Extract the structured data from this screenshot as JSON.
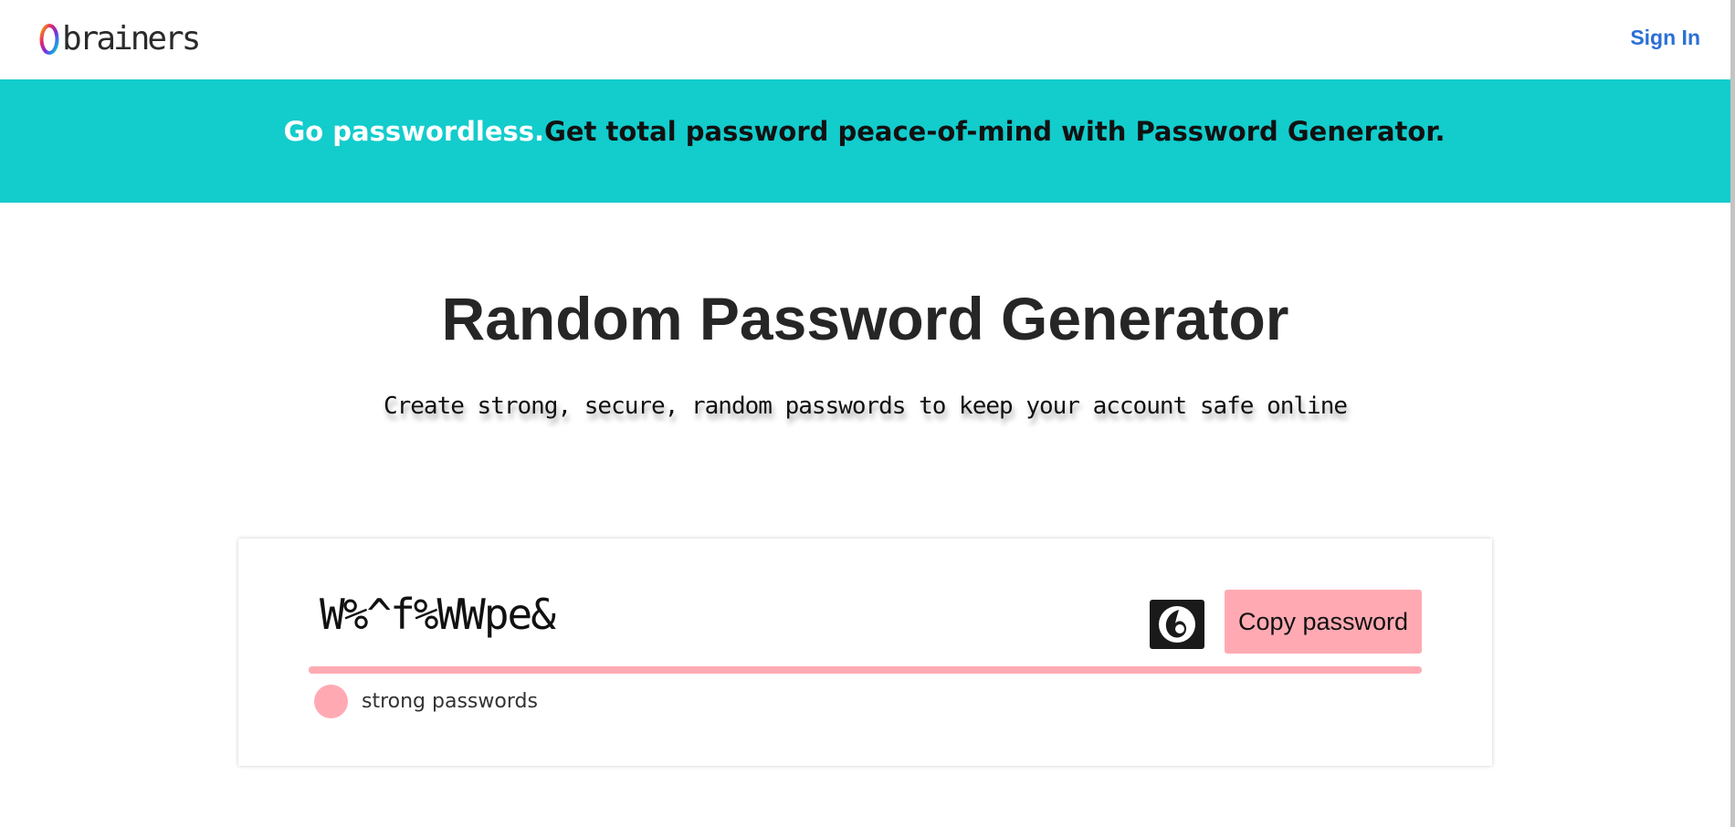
{
  "header": {
    "logo_text": "brainers",
    "signin_label": "Sign In"
  },
  "banner": {
    "lead": "Go passwordless.",
    "text": "Get total password peace-of-mind with Password Generator."
  },
  "hero": {
    "title": "Random Password Generator",
    "subtitle": "Create strong, secure, random passwords to keep your account safe online"
  },
  "generator": {
    "password": "W%^f%WWpe&",
    "copy_label": "Copy password",
    "strength_label": "strong passwords",
    "strength_level": 1.0
  },
  "colors": {
    "banner_bg": "#13cccc",
    "accent_pink": "#ffaab3",
    "link_blue": "#2b6fd6",
    "title_text": "#262626"
  },
  "icons": {
    "refresh": "refresh-icon",
    "logo": "brainers-ring-logo"
  }
}
